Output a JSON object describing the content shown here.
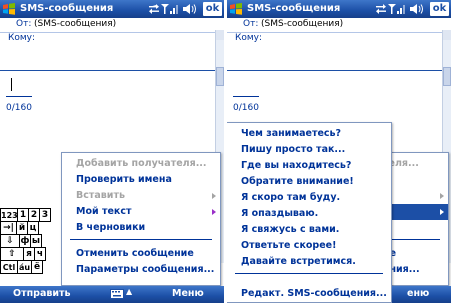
{
  "app": {
    "title": "SMS-сообщения",
    "ok_label": "ok"
  },
  "compose": {
    "from_label": "От:",
    "from_value": "(SMS-сообщения)",
    "to_label": "Кому:",
    "to_value": "",
    "char_counter": "0/160"
  },
  "left_menu": {
    "items": [
      {
        "label": "Добавить получателя...",
        "enabled": false
      },
      {
        "label": "Проверить имена",
        "enabled": true
      },
      {
        "label": "Вставить",
        "enabled": false,
        "submenu": true
      },
      {
        "label": "Мой текст",
        "enabled": true,
        "submenu": true
      },
      {
        "label": "В черновики",
        "enabled": true
      },
      {
        "label": "Отменить сообщение",
        "enabled": true
      },
      {
        "label": "Параметры сообщения...",
        "enabled": true
      }
    ]
  },
  "right_menu_behind": {
    "partial_labels": [
      "теля...",
      "ие",
      "ения..."
    ]
  },
  "mytext_submenu": {
    "items": [
      {
        "label": "Чем занимаетесь?"
      },
      {
        "label": "Пишу просто так..."
      },
      {
        "label": "Где вы находитесь?"
      },
      {
        "label": "Обратите внимание!"
      },
      {
        "label": "Я скоро там буду."
      },
      {
        "label": "Я опаздываю."
      },
      {
        "label": "Я свяжусь с вами."
      },
      {
        "label": "Ответьте скорее!"
      },
      {
        "label": "Давайте встретимся."
      },
      {
        "label": "Редакт. SMS-сообщения..."
      }
    ]
  },
  "keyboard": {
    "row1": [
      "123",
      "1",
      "2",
      "3"
    ],
    "row2": [
      "→|",
      "й",
      "ц"
    ],
    "row3": [
      "⇩",
      "ф",
      "ы"
    ],
    "row4": [
      "⇧",
      "я",
      "ч"
    ],
    "row5": [
      "Ctl",
      "áu",
      "ё"
    ]
  },
  "softkeys": {
    "left": "Отправить",
    "right": "Меню",
    "right_partial": "еню"
  },
  "colors": {
    "titlebar": "#1c4fa6",
    "menu_text": "#003399",
    "disabled_text": "#a4a4a4",
    "highlight": "#1c4fa6"
  },
  "icons": {
    "start": "windows-logo-icon",
    "connectivity": "sync-arrows-icon",
    "signal": "signal-strength-icon",
    "volume": "speaker-volume-icon",
    "input_panel": "keyboard-icon"
  }
}
